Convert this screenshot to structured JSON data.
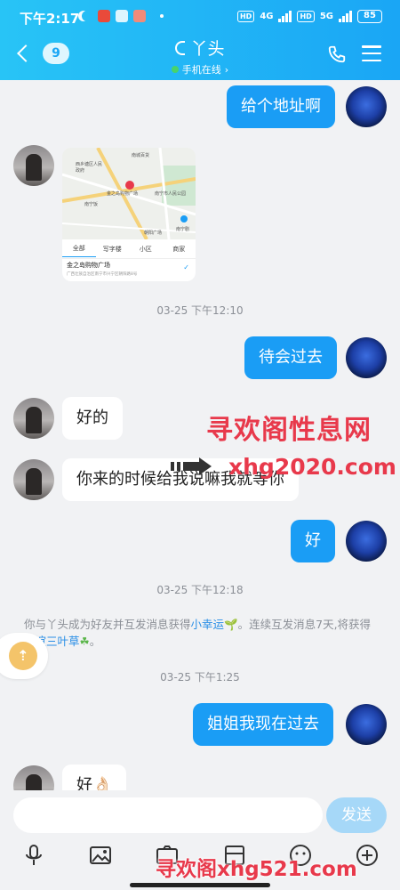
{
  "status_bar": {
    "time": "下午2:17",
    "net_4g": "4G",
    "net_5g": "5G",
    "hd1": "HD",
    "hd2": "HD",
    "battery": "85"
  },
  "header": {
    "unread_count": "9",
    "contact_name": "丫头",
    "online_status": "手机在线",
    "online_chevron": "›"
  },
  "messages": [
    {
      "dir": "out",
      "text": "给个地址啊"
    },
    {
      "dir": "in",
      "type": "location"
    },
    {
      "dir": "out",
      "text": "待会过去"
    },
    {
      "dir": "in",
      "text": "好的"
    },
    {
      "dir": "in",
      "text": "你来的时候给我说嘛我就等你"
    },
    {
      "dir": "out",
      "text": "好"
    },
    {
      "dir": "out",
      "text": "姐姐我现在过去"
    },
    {
      "dir": "in",
      "text": "好👌🏻"
    }
  ],
  "timestamps": [
    "03-25 下午12:10",
    "03-25 下午12:18",
    "03-25 下午1:25"
  ],
  "location_card": {
    "tabs": [
      "全部",
      "写字楼",
      "小区",
      "商家"
    ],
    "place_name": "金之岛购物广场",
    "address": "广西壮族自治区南宁市兴宁区朝阳路8号",
    "map_labels": [
      "南城百货",
      "西乡塘区人民政府",
      "金之岛购物广场",
      "南宁饭",
      "南宁市人民公园",
      "朝阳广场",
      "南宁剧"
    ]
  },
  "system_notice": {
    "part1": "你与丫头成为好友并互发消息获得",
    "link1": "小幸运",
    "leaf1": "🌱",
    "part2": "。连续互发消息7天,将获得",
    "link2": "友谊三叶草",
    "leaf2": "☘",
    "part3": "。"
  },
  "float_button": "⇡",
  "watermark": {
    "line1": "寻欢阁性息网",
    "line2": "xhg2020.com",
    "line3": "寻欢阁xhg521.com"
  },
  "input": {
    "placeholder": "",
    "value": "",
    "send_label": "发送"
  },
  "toolbar_icons": [
    "microphone-icon",
    "photo-icon",
    "camera-icon",
    "image-folder-icon",
    "emoji-icon",
    "plus-icon"
  ],
  "colors": {
    "header_start": "#28c4f6",
    "header_end": "#1aa6f5",
    "outgoing_bubble": "#1a9df5",
    "incoming_bubble": "#ffffff",
    "watermark": "#e8394b",
    "send_button": "#a6d8f8"
  }
}
